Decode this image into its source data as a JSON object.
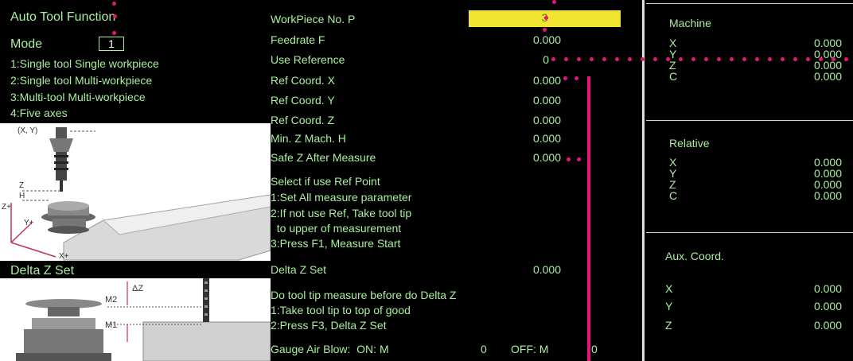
{
  "left": {
    "title": "Auto Tool Function",
    "mode_label": "Mode",
    "mode_value": "1",
    "mode_options": [
      "1:Single tool Single workpiece",
      "2:Single tool Multi-workpiece",
      "3:Multi-tool Multi-workpiece",
      "4:Five axes"
    ],
    "diagram1_labels": {
      "xy": "(X, Y)",
      "z": "Z",
      "h": "H",
      "zplus": "Z+",
      "yplus": "Y+",
      "xplus": "X+"
    },
    "delta_z_title": "Delta Z Set",
    "diagram2_labels": {
      "dz": "ΔZ",
      "m2": "M2",
      "m1": "M1"
    }
  },
  "middle": {
    "rows": [
      {
        "label": "WorkPiece No. P",
        "value": "3"
      },
      {
        "label": "Feedrate F",
        "value": "0.000"
      },
      {
        "label": "Use Reference",
        "value": "0"
      },
      {
        "label": "Ref Coord. X",
        "value": "0.000"
      },
      {
        "label": "Ref Coord. Y",
        "value": "0.000"
      },
      {
        "label": "Ref Coord. Z",
        "value": "0.000"
      },
      {
        "label": "Min. Z Mach. H",
        "value": "0.000"
      },
      {
        "label": "Safe Z After Measure",
        "value": "0.000"
      }
    ],
    "ref_instructions": [
      "Select if use Ref Point",
      "1:Set All measure parameter",
      "2:If not use Ref, Take tool tip",
      "  to upper of measurement",
      "3:Press F1, Measure Start"
    ],
    "delta_z": {
      "label": "Delta Z Set",
      "value": "0.000"
    },
    "dz_instructions": [
      "Do tool tip measure before do Delta Z",
      "1:Take tool tip to top of good",
      "2:Press F3, Delta Z Set"
    ],
    "gauge": {
      "label": "Gauge Air Blow:  ON: M",
      "on_value": "0",
      "off_label": "OFF: M",
      "off_value": "0"
    }
  },
  "right": {
    "machine": {
      "title": "Machine",
      "axes": [
        "X",
        "Y",
        "Z",
        "C"
      ],
      "values": [
        "0.000",
        "0.000",
        "0.000",
        "0.000"
      ]
    },
    "relative": {
      "title": "Relative",
      "axes": [
        "X",
        "Y",
        "Z",
        "C"
      ],
      "values": [
        "0.000",
        "0.000",
        "0.000",
        "0.000"
      ]
    },
    "aux": {
      "title": "Aux. Coord.",
      "axes": [
        "X",
        "Y",
        "Z"
      ],
      "values": [
        "0.000",
        "0.000",
        "0.000"
      ]
    }
  },
  "colors": {
    "background": "#000000",
    "text": "#a8ee9c",
    "highlight": "#f2e531",
    "annotation": "#e8127c"
  }
}
